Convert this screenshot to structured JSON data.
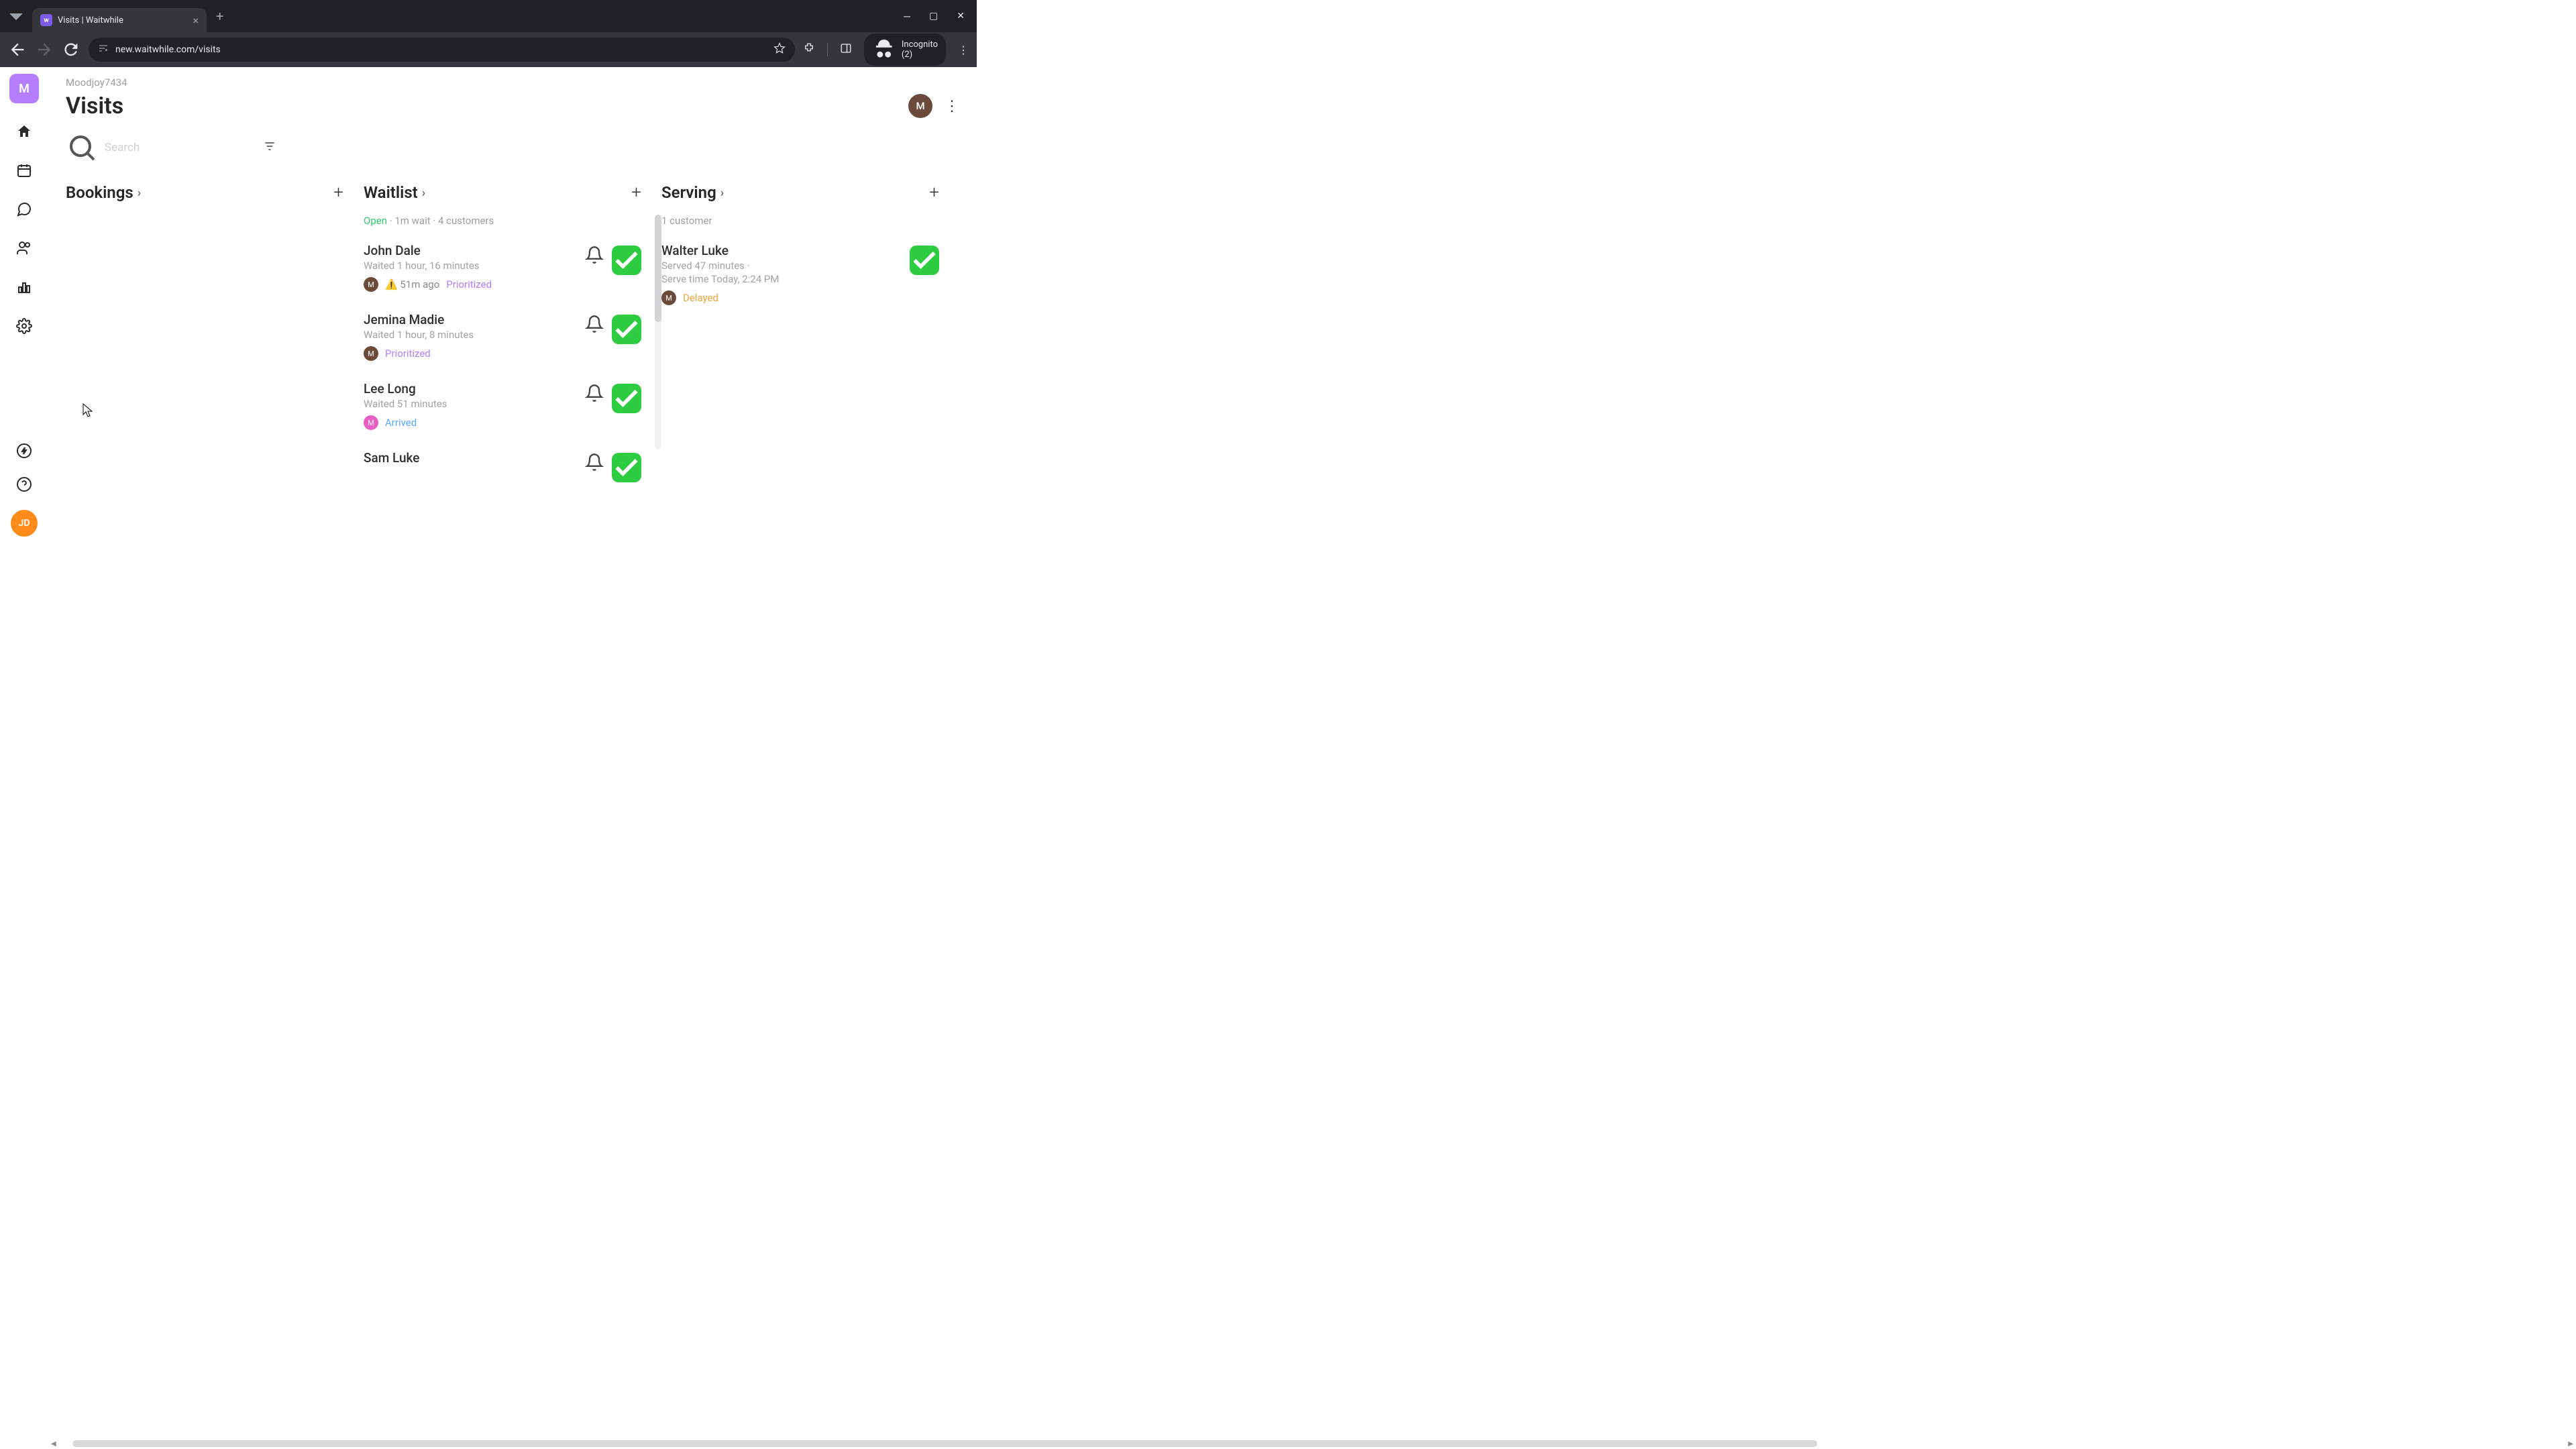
{
  "browser": {
    "tab_title": "Visits | Waitwhile",
    "url": "new.waitwhile.com/visits",
    "incognito_label": "Incognito (2)"
  },
  "workspace": "Moodjoy7434",
  "page_title": "Visits",
  "user_avatar_letter": "M",
  "user_initials_bottom": "JD",
  "search": {
    "placeholder": "Search"
  },
  "columns": {
    "bookings": {
      "title": "Bookings"
    },
    "waitlist": {
      "title": "Waitlist",
      "status_open": "Open",
      "status_rest": " · 1m wait · 4 customers",
      "items": [
        {
          "name": "John Dale",
          "sub": "Waited 1 hour, 16 minutes",
          "badge": "M",
          "badge_pink": false,
          "time": "⚠️ 51m ago",
          "tag": "Prioritized",
          "tag_class": "tag-prio"
        },
        {
          "name": "Jemina Madie",
          "sub": "Waited 1 hour, 8 minutes",
          "badge": "M",
          "badge_pink": false,
          "time": "",
          "tag": "Prioritized",
          "tag_class": "tag-prio"
        },
        {
          "name": "Lee Long",
          "sub": "Waited 51 minutes",
          "badge": "M",
          "badge_pink": true,
          "time": "",
          "tag": "Arrived",
          "tag_class": "tag-arrived"
        },
        {
          "name": "Sam Luke",
          "sub": "",
          "badge": "",
          "badge_pink": false,
          "time": "",
          "tag": "",
          "tag_class": ""
        }
      ]
    },
    "serving": {
      "title": "Serving",
      "meta": "1 customer",
      "items": [
        {
          "name": "Walter Luke",
          "sub": "Served 47 minutes ·",
          "sub2": "Serve time Today, 2:24 PM",
          "badge": "M",
          "tag": "Delayed",
          "tag_class": "tag-delayed"
        }
      ]
    }
  }
}
